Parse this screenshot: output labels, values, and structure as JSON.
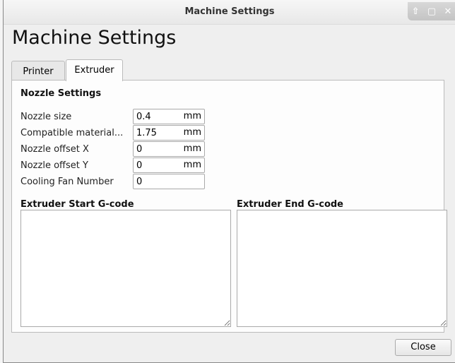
{
  "window": {
    "title": "Machine Settings",
    "controls": [
      "up-icon",
      "maximize-icon",
      "close-icon"
    ]
  },
  "heading": "Machine Settings",
  "tabs": [
    {
      "label": "Printer",
      "active": false
    },
    {
      "label": "Extruder",
      "active": true
    }
  ],
  "nozzle": {
    "title": "Nozzle Settings",
    "fields": [
      {
        "label": "Nozzle size",
        "value": "0.4",
        "unit": "mm"
      },
      {
        "label": "Compatible material...",
        "value": "1.75",
        "unit": "mm"
      },
      {
        "label": "Nozzle offset X",
        "value": "0",
        "unit": "mm"
      },
      {
        "label": "Nozzle offset Y",
        "value": "0",
        "unit": "mm"
      },
      {
        "label": "Cooling Fan Number",
        "value": "0",
        "unit": ""
      }
    ]
  },
  "start_gcode": {
    "title": "Extruder Start G-code",
    "value": ""
  },
  "end_gcode": {
    "title": "Extruder End G-code",
    "value": ""
  },
  "close_label": "Close"
}
